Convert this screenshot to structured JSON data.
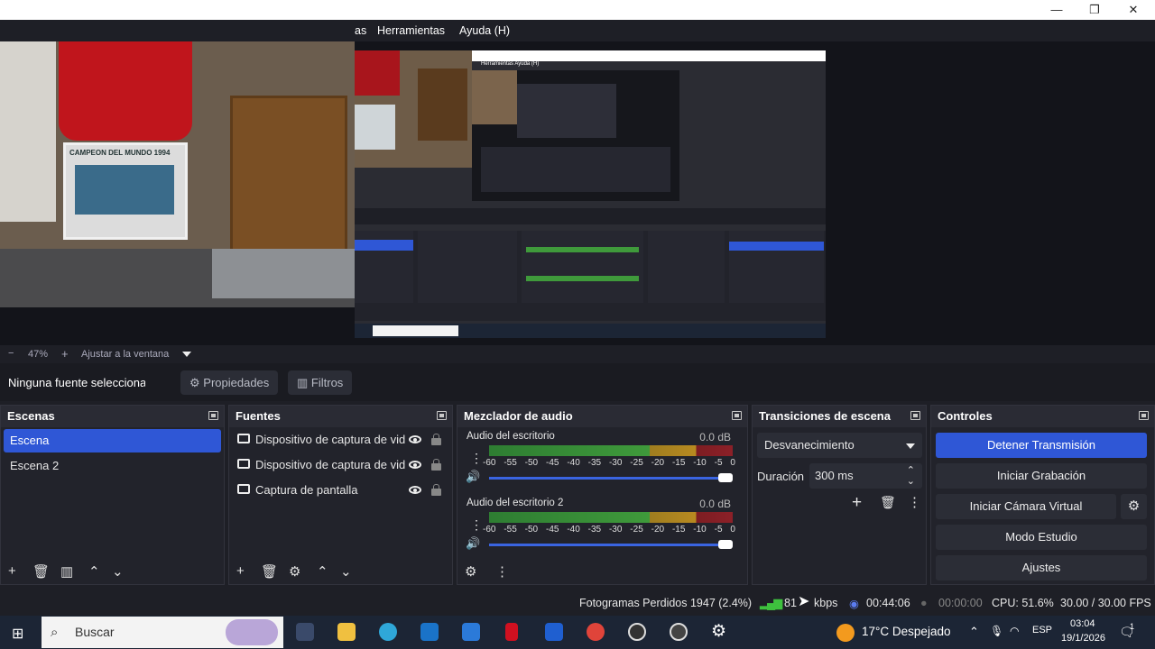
{
  "menu": {
    "partial_item": "as",
    "tools": "Herramientas",
    "help": "Ayuda (H)"
  },
  "window_controls": {
    "minimize": "—",
    "restore": "❐",
    "close": "✕"
  },
  "preview": {
    "webcam_text": "CAMPEON DEL MUNDO 1994",
    "nested_title_text": "Herramientas   Ayuda (H)"
  },
  "zoom": {
    "minus": "−",
    "value": "47%",
    "plus": "+",
    "fit_label": "Ajustar a la ventana"
  },
  "context": {
    "no_source": "Ninguna fuente seleccionad",
    "properties": "Propiedades",
    "filters": "Filtros"
  },
  "scenes": {
    "title": "Escenas",
    "items": [
      "Escena",
      "Escena 2"
    ],
    "selected": "Escena"
  },
  "sources": {
    "title": "Fuentes",
    "items": [
      "Dispositivo de captura de vid",
      "Dispositivo de captura de vid",
      "Captura de pantalla"
    ]
  },
  "mixer": {
    "title": "Mezclador de audio",
    "channels": [
      {
        "name": "Audio del escritorio",
        "db": "0.0 dB"
      },
      {
        "name": "Audio del escritorio 2",
        "db": "0.0 dB"
      }
    ],
    "ticks": [
      "-60",
      "-55",
      "-50",
      "-45",
      "-40",
      "-35",
      "-30",
      "-25",
      "-20",
      "-15",
      "-10",
      "-5",
      "0"
    ]
  },
  "transitions": {
    "title": "Transiciones de escena",
    "selected": "Desvanecimiento",
    "duration_label": "Duración",
    "duration_value": "300 ms"
  },
  "controls": {
    "title": "Controles",
    "stop_stream": "Detener Transmisión",
    "start_recording": "Iniciar Grabación",
    "start_virtual_cam": "Iniciar Cámara Virtual",
    "studio_mode": "Modo Estudio",
    "settings": "Ajustes"
  },
  "status": {
    "dropped_frames": "Fotogramas Perdidos 1947 (2.4%)",
    "bitrate": "81",
    "bitrate_tail": "kbps",
    "stream_time": "00:44:06",
    "rec_time": "00:00:00",
    "cpu": "CPU: 51.6%",
    "fps": "30.00 / 30.00 FPS"
  },
  "taskbar": {
    "search_placeholder": "Buscar",
    "weather": "17°C  Despejado",
    "lang": "ESP",
    "time": "03:04",
    "date": "19/1/2026",
    "notification_count": "1"
  },
  "colors": {
    "accent": "#2f57d6",
    "panel": "#22232b",
    "background": "#1e1f26"
  }
}
